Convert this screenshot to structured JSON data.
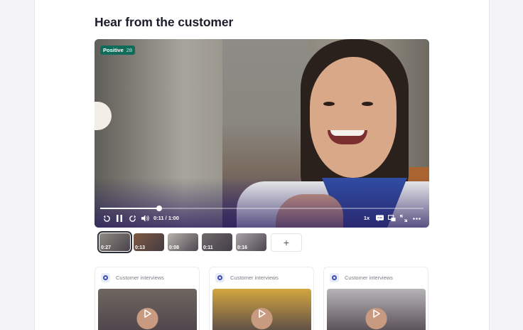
{
  "section": {
    "title": "Hear from the customer"
  },
  "player": {
    "sentiment_label": "Positive",
    "sentiment_count": "28",
    "progress": 0.183,
    "time_display": "0:11 / 1:00",
    "speed": "1x",
    "icons": [
      "rewind-icon",
      "pause-icon",
      "forward-icon",
      "volume-icon",
      "captions-icon",
      "pip-icon",
      "fullscreen-icon",
      "more-icon"
    ]
  },
  "clips": [
    {
      "label": "0:27",
      "color": "#8f8a80"
    },
    {
      "label": "0:13",
      "color": "#7e5a44"
    },
    {
      "label": "0:08",
      "color": "#b7b2aa"
    },
    {
      "label": "0:11",
      "color": "#6f6a6a"
    },
    {
      "label": "0:16",
      "color": "#a9a3a7"
    }
  ],
  "add_clip_label": "+",
  "cards": [
    {
      "source": "Customer interviews",
      "thumb_color": "#6f6660"
    },
    {
      "source": "Customer interviews",
      "thumb_color": "#d3a640"
    },
    {
      "source": "Customer interviews",
      "thumb_color": "#b6b4b6"
    }
  ],
  "colors": {
    "accent": "#0f6b5a",
    "title": "#1b1d2a",
    "brand_icon": "#3b4bb0"
  }
}
